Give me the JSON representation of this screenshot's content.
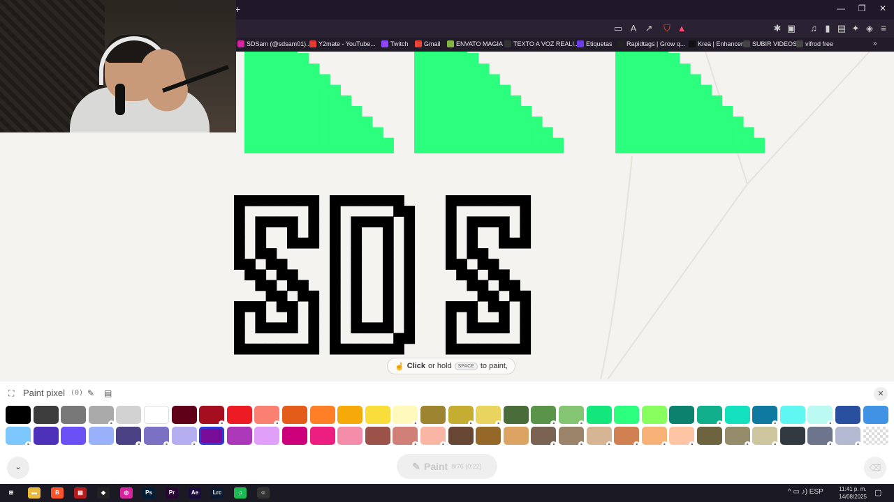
{
  "browser": {
    "new_tab": "+",
    "window": {
      "minimize": "—",
      "restore": "❐",
      "close": "✕"
    },
    "bookmarks": [
      {
        "label": "SDSam (@sdsam01)...",
        "color": "#d6249f"
      },
      {
        "label": "Y2mate - YouTube...",
        "color": "#e53935"
      },
      {
        "label": "Twitch",
        "color": "#9146ff"
      },
      {
        "label": "Gmail",
        "color": "#ea4335"
      },
      {
        "label": "ENVATO MAGIA",
        "color": "#82b541"
      },
      {
        "label": "TEXTO A VOZ REALI...",
        "color": "#333333"
      },
      {
        "label": "Etiquetas",
        "color": "#6a3de8"
      },
      {
        "label": "Rapidtags | Grow q...",
        "color": "#222222"
      },
      {
        "label": "Krea | Enhancer",
        "color": "#111111"
      },
      {
        "label": "SUBIR VIDEOS",
        "color": "#444444"
      },
      {
        "label": "vifrod free",
        "color": "#444444"
      }
    ],
    "more": "»"
  },
  "canvas": {
    "accent_green": "#2bff7d",
    "hint": {
      "bold": "Click",
      "text1": "or hold",
      "key": "SPACE",
      "text2": "to paint,"
    }
  },
  "panel": {
    "title": "Paint pixel",
    "count": "(0)",
    "close": "✕",
    "paint_button": {
      "label": "Paint",
      "counter": "8/76 (0:22)"
    },
    "colors_row1": [
      {
        "hex": "#000000",
        "locked": false
      },
      {
        "hex": "#3c3c3c",
        "locked": false
      },
      {
        "hex": "#787878",
        "locked": false
      },
      {
        "hex": "#aaaaaa",
        "locked": true
      },
      {
        "hex": "#d2d2d2",
        "locked": false
      },
      {
        "hex": "#ffffff",
        "locked": false
      },
      {
        "hex": "#600018",
        "locked": false
      },
      {
        "hex": "#a50e1e",
        "locked": true
      },
      {
        "hex": "#ed1c24",
        "locked": false
      },
      {
        "hex": "#fa8072",
        "locked": true
      },
      {
        "hex": "#e45c1a",
        "locked": false
      },
      {
        "hex": "#ff7f27",
        "locked": false
      },
      {
        "hex": "#f6aa09",
        "locked": false
      },
      {
        "hex": "#f9dd3b",
        "locked": false
      },
      {
        "hex": "#fffabc",
        "locked": true
      },
      {
        "hex": "#9c8431",
        "locked": false
      },
      {
        "hex": "#c5ad31",
        "locked": true
      },
      {
        "hex": "#e8d45f",
        "locked": true
      },
      {
        "hex": "#4a6b3a",
        "locked": false
      },
      {
        "hex": "#5a944a",
        "locked": true
      },
      {
        "hex": "#84c573",
        "locked": true
      },
      {
        "hex": "#13e67b",
        "locked": false
      },
      {
        "hex": "#2bff7d",
        "locked": false
      },
      {
        "hex": "#87ff5e",
        "locked": false
      },
      {
        "hex": "#0c816e",
        "locked": false
      },
      {
        "hex": "#10ae8a",
        "locked": true
      },
      {
        "hex": "#13e1be",
        "locked": false
      },
      {
        "hex": "#0f799f",
        "locked": true
      },
      {
        "hex": "#60f7f2",
        "locked": false
      },
      {
        "hex": "#bbfaf2",
        "locked": true
      },
      {
        "hex": "#28509e",
        "locked": false
      },
      {
        "hex": "#4093e4",
        "locked": false
      }
    ],
    "colors_row2": [
      {
        "hex": "#7dc7ff",
        "locked": true
      },
      {
        "hex": "#4d31b8",
        "locked": false
      },
      {
        "hex": "#6b50f6",
        "locked": false
      },
      {
        "hex": "#99b1fb",
        "locked": false
      },
      {
        "hex": "#4a4284",
        "locked": true
      },
      {
        "hex": "#7a71c4",
        "locked": true
      },
      {
        "hex": "#b5aef1",
        "locked": true
      },
      {
        "hex": "#780c99",
        "locked": false,
        "selected": true
      },
      {
        "hex": "#aa38b9",
        "locked": false
      },
      {
        "hex": "#e09ff9",
        "locked": false
      },
      {
        "hex": "#cb007a",
        "locked": false
      },
      {
        "hex": "#ec1f80",
        "locked": false
      },
      {
        "hex": "#f38da9",
        "locked": false
      },
      {
        "hex": "#9b5249",
        "locked": false
      },
      {
        "hex": "#d18078",
        "locked": true
      },
      {
        "hex": "#fab6a4",
        "locked": true
      },
      {
        "hex": "#684634",
        "locked": false
      },
      {
        "hex": "#95682a",
        "locked": false
      },
      {
        "hex": "#dba463",
        "locked": false
      },
      {
        "hex": "#7b6352",
        "locked": true
      },
      {
        "hex": "#9c846b",
        "locked": true
      },
      {
        "hex": "#d6b594",
        "locked": true
      },
      {
        "hex": "#d18051",
        "locked": true
      },
      {
        "hex": "#f8b277",
        "locked": true
      },
      {
        "hex": "#ffc5a5",
        "locked": true
      },
      {
        "hex": "#6d643f",
        "locked": false
      },
      {
        "hex": "#948c6b",
        "locked": true
      },
      {
        "hex": "#cdc59e",
        "locked": true
      },
      {
        "hex": "#333941",
        "locked": false
      },
      {
        "hex": "#6d758d",
        "locked": true
      },
      {
        "hex": "#b3b9d1",
        "locked": true
      },
      {
        "hex": "transparent",
        "locked": false
      }
    ]
  },
  "taskbar": {
    "apps": [
      {
        "name": "windows-start-icon",
        "glyph": "⊞",
        "color": "#1b1a24"
      },
      {
        "name": "file-explorer-icon",
        "glyph": "▬",
        "color": "#e8b93a"
      },
      {
        "name": "brave-browser-icon",
        "glyph": "B",
        "color": "#fb542b"
      },
      {
        "name": "video-app-icon",
        "glyph": "▤",
        "color": "#b71c1c"
      },
      {
        "name": "capcut-icon",
        "glyph": "◆",
        "color": "#222222"
      },
      {
        "name": "instagram-icon",
        "glyph": "◎",
        "color": "#d6249f"
      },
      {
        "name": "photoshop-icon",
        "glyph": "Ps",
        "color": "#001e36"
      },
      {
        "name": "premiere-icon",
        "glyph": "Pr",
        "color": "#2a0634"
      },
      {
        "name": "after-effects-icon",
        "glyph": "Ae",
        "color": "#1a0a3e"
      },
      {
        "name": "lightroom-classic-icon",
        "glyph": "Lrc",
        "color": "#0a1a30"
      },
      {
        "name": "spotify-icon",
        "glyph": "♫",
        "color": "#1db954"
      },
      {
        "name": "obs-icon",
        "glyph": "☺",
        "color": "#333333"
      }
    ],
    "tray": "^  ▭  ♪)  ESP",
    "time": "11:41 p. m.",
    "date": "14/08/2025",
    "notifications": "▢"
  }
}
